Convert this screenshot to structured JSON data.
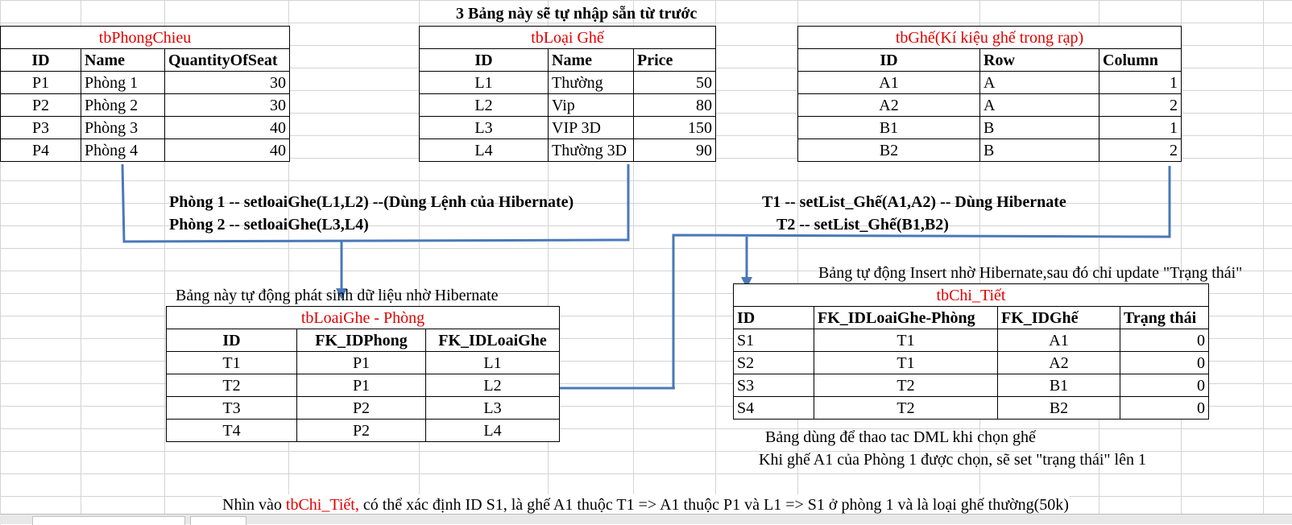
{
  "header_note": "3 Bảng này sẽ tự nhập sẵn từ trước",
  "tbPhongChieu": {
    "title": "tbPhongChieu",
    "columns": [
      "ID",
      "Name",
      "QuantityOfSeat"
    ],
    "rows": [
      [
        "P1",
        "Phòng 1",
        "30"
      ],
      [
        "P2",
        "Phòng 2",
        "30"
      ],
      [
        "P3",
        "Phòng 3",
        "40"
      ],
      [
        "P4",
        "Phòng 4",
        "40"
      ]
    ]
  },
  "tbLoaiGhe": {
    "title": "tbLoại Ghế",
    "columns": [
      "ID",
      "Name",
      "Price"
    ],
    "rows": [
      [
        "L1",
        "Thường",
        "50"
      ],
      [
        "L2",
        "Vip",
        "80"
      ],
      [
        "L3",
        "VIP 3D",
        "150"
      ],
      [
        "L4",
        "Thường 3D",
        "90"
      ]
    ]
  },
  "tbGhe": {
    "title": "tbGhế(Kí kiệu ghế trong rạp)",
    "columns": [
      "ID",
      "Row",
      "Column"
    ],
    "rows": [
      [
        "A1",
        "A",
        "1"
      ],
      [
        "A2",
        "A",
        "2"
      ],
      [
        "B1",
        "B",
        "1"
      ],
      [
        "B2",
        "B",
        "2"
      ]
    ]
  },
  "notes_left": {
    "line1": "Phòng 1 -- setloaiGhe(L1,L2)   --(Dùng Lệnh của Hibernate)",
    "line2": "Phòng 2 -- setloaiGhe(L3,L4)"
  },
  "notes_right": {
    "line1": "T1 -- setList_Ghế(A1,A2)  -- Dùng Hibernate",
    "line2": "T2 -- setList_Ghế(B1,B2)"
  },
  "auto_gen_note": "Bảng này tự động phát     sinh dữ liệu nhờ Hibernate",
  "tbLoaiGhePhong": {
    "title": "tbLoaiGhe - Phòng",
    "columns": [
      "ID",
      "FK_IDPhong",
      "FK_IDLoaiGhe"
    ],
    "rows": [
      [
        "T1",
        "P1",
        "L1"
      ],
      [
        "T2",
        "P1",
        "L2"
      ],
      [
        "T3",
        "P2",
        "L3"
      ],
      [
        "T4",
        "P2",
        "L4"
      ]
    ]
  },
  "auto_insert_note": "Bảng tự động Insert nhờ Hibernate,sau đó chỉ update \"Trạng thái\"",
  "tbChiTiet": {
    "title": "tbChi_Tiết",
    "columns": [
      "ID",
      "FK_IDLoaiGhe-Phòng",
      "FK_IDGhế",
      "Trạng thái"
    ],
    "rows": [
      [
        "S1",
        "T1",
        "A1",
        "0"
      ],
      [
        "S2",
        "T1",
        "A2",
        "0"
      ],
      [
        "S3",
        "T2",
        "B1",
        "0"
      ],
      [
        "S4",
        "T2",
        "B2",
        "0"
      ]
    ]
  },
  "dml_note": "Bảng dùng để thao tac DML khi chọn ghế",
  "select_note": "Khi ghế A1 của Phòng 1 được chọn, sẽ set \"trạng thái\" lên 1",
  "footer": {
    "prefix": "Nhìn vào ",
    "highlight": "tbChi_Tiết,",
    "suffix": " có thể xác định ID S1, là ghế A1 thuộc T1 => A1 thuộc P1 và L1 => S1 ở phòng 1 và là loại ghế thường(50k)"
  },
  "colors": {
    "title_red": "#e00000",
    "connector_blue": "#4a78b8",
    "grid": "#d4d4d4"
  }
}
